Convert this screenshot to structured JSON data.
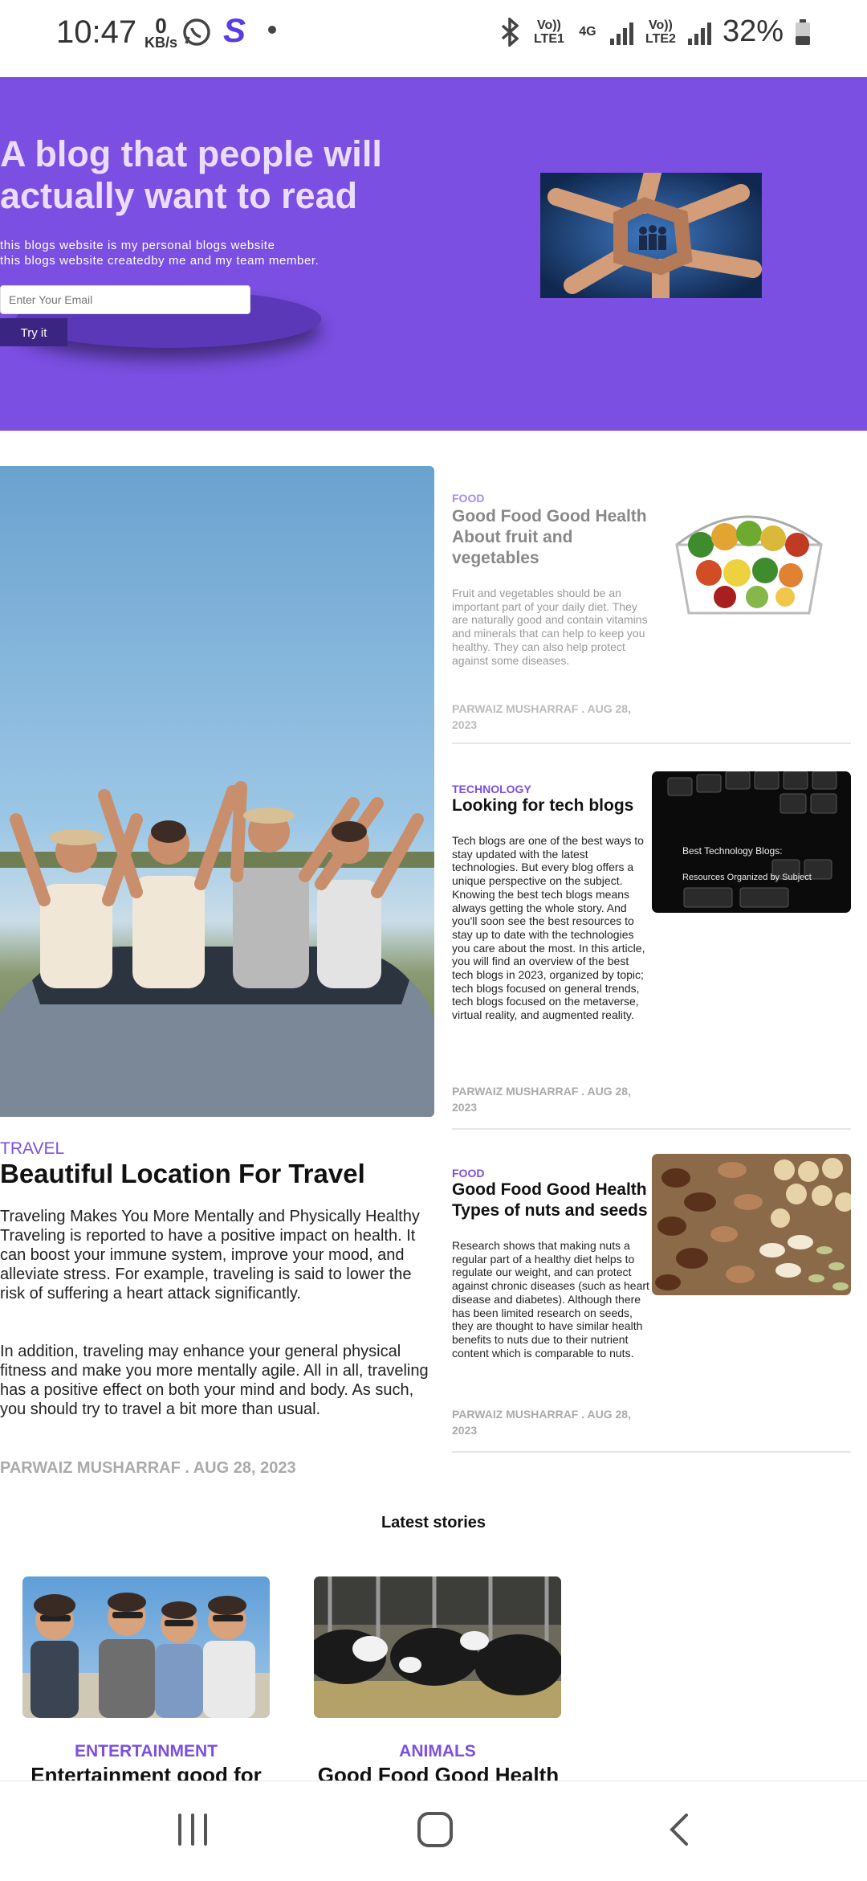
{
  "status_bar": {
    "time": "10:47",
    "kbs_value": "0",
    "kbs_unit": "KB/s",
    "sim1_label": "Vo)) LTE1",
    "network_4g": "4G",
    "sim2_label": "Vo)) LTE2",
    "battery": "32%"
  },
  "hero": {
    "title": "A blog that people will actually want to read",
    "subtitle_line1": "this blogs website is my personal blogs website",
    "subtitle_line2": "this blogs website createdby me and my team member.",
    "email_placeholder": "Enter Your Email",
    "try_button": "Try it"
  },
  "feature": {
    "category": "TRAVEL",
    "title": "Beautiful Location For Travel",
    "paragraph1": "Traveling Makes You More Mentally and Physically Healthy Traveling is reported to have a positive impact on health. It can boost your immune system, improve your mood, and alleviate stress. For example, traveling is said to lower the risk of suffering a heart attack significantly.",
    "paragraph2": "In addition, traveling may enhance your general physical fitness and make you more mentally agile. All in all, traveling has a positive effect on both your mind and body. As such, you should try to travel a bit more than usual.",
    "meta": "PARWAIZ MUSHARRAF . AUG 28, 2023"
  },
  "side_articles": [
    {
      "category": "FOOD",
      "title": "Good Food Good Health About fruit and vegetables",
      "body": "Fruit and vegetables should be an important part of your daily diet. They are naturally good and contain vitamins and minerals that can help to keep you healthy. They can also help protect against some diseases.",
      "meta": "PARWAIZ MUSHARRAF . AUG 28, 2023"
    },
    {
      "category": "TECHNOLOGY",
      "title": "Looking for tech blogs",
      "body": "Tech blogs are one of the best ways to stay updated with the latest technologies. But every blog offers a unique perspective on the subject. Knowing the best tech blogs means always getting the whole story. And you'll soon see the best resources to stay up to date with the technologies you care about the most. In this article, you will find an overview of the best tech blogs in 2023, organized by topic; tech blogs focused on general trends, tech blogs focused on the metaverse, virtual reality, and augmented reality.",
      "meta": "PARWAIZ MUSHARRAF . AUG 28, 2023",
      "image_caption_1": "Best Technology Blogs:",
      "image_caption_2": "Resources Organized by Subject"
    },
    {
      "category": "FOOD",
      "title": "Good Food Good Health Types of nuts and seeds",
      "body": "Research shows that making nuts a regular part of a healthy diet helps to regulate our weight, and can protect against chronic diseases (such as heart disease and diabetes). Although there has been limited research on seeds, they are thought to have similar health benefits to nuts due to their nutrient content which is comparable to nuts.",
      "meta": "PARWAIZ MUSHARRAF . AUG 28, 2023"
    }
  ],
  "latest": {
    "heading": "Latest stories",
    "stories": [
      {
        "category": "ENTERTAINMENT",
        "title": "Entertainment good for"
      },
      {
        "category": "ANIMALS",
        "title": "Good Food Good Health"
      }
    ]
  },
  "icons": {
    "status": [
      "whatsapp-icon",
      "s-app-icon",
      "bluetooth-icon",
      "signal-icon",
      "battery-icon"
    ],
    "nav": [
      "recents-icon",
      "home-icon",
      "back-icon"
    ]
  },
  "colors": {
    "accent": "#7a4fe2",
    "hero_bg": "#7a4fe2",
    "button_dark": "#3b2582"
  }
}
